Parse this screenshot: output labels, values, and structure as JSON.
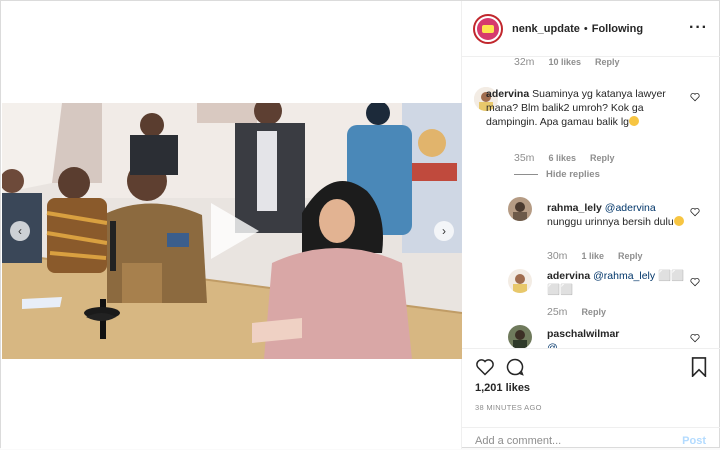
{
  "post": {
    "username": "nenk_update",
    "separator": "•",
    "follow_status": "Following"
  },
  "comments": {
    "top_meta": {
      "time": "32m",
      "likes": "10 likes",
      "reply": "Reply"
    },
    "c1": {
      "username": "adervina",
      "text": "Suaminya yg katanya lawyer mana? Blm balik2 umroh? Kok ga dampingin. Apa gamau balik lg",
      "time": "35m",
      "likes": "6 likes",
      "reply": "Reply",
      "hide_replies": "Hide replies"
    },
    "r1": {
      "username": "rahma_lely",
      "mention": "@adervina",
      "text": "nunggu urinnya bersih dulu",
      "time": "30m",
      "likes": "1 like",
      "reply": "Reply"
    },
    "r2": {
      "username": "adervina",
      "mention": "@rahma_lely",
      "text": "⬜⬜\n⬜⬜",
      "time": "25m",
      "reply": "Reply"
    },
    "r3": {
      "username": "paschalwilmar",
      "text": "@..."
    }
  },
  "actions": {
    "likes": "1,201 likes",
    "time_ago": "38 MINUTES AGO",
    "add_comment_placeholder": "Add a comment...",
    "post_label": "Post"
  },
  "icons": {
    "more": "more-options-icon",
    "heart": "heart-icon",
    "comment": "comment-icon",
    "bookmark": "bookmark-icon",
    "play": "play-icon",
    "prev": "chevron-left-icon",
    "next": "chevron-right-icon"
  },
  "colors": {
    "link": "#003569",
    "muted": "#8e8e8e",
    "post_disabled": "#b3dbff",
    "avatar_ring": "#c1272d"
  }
}
